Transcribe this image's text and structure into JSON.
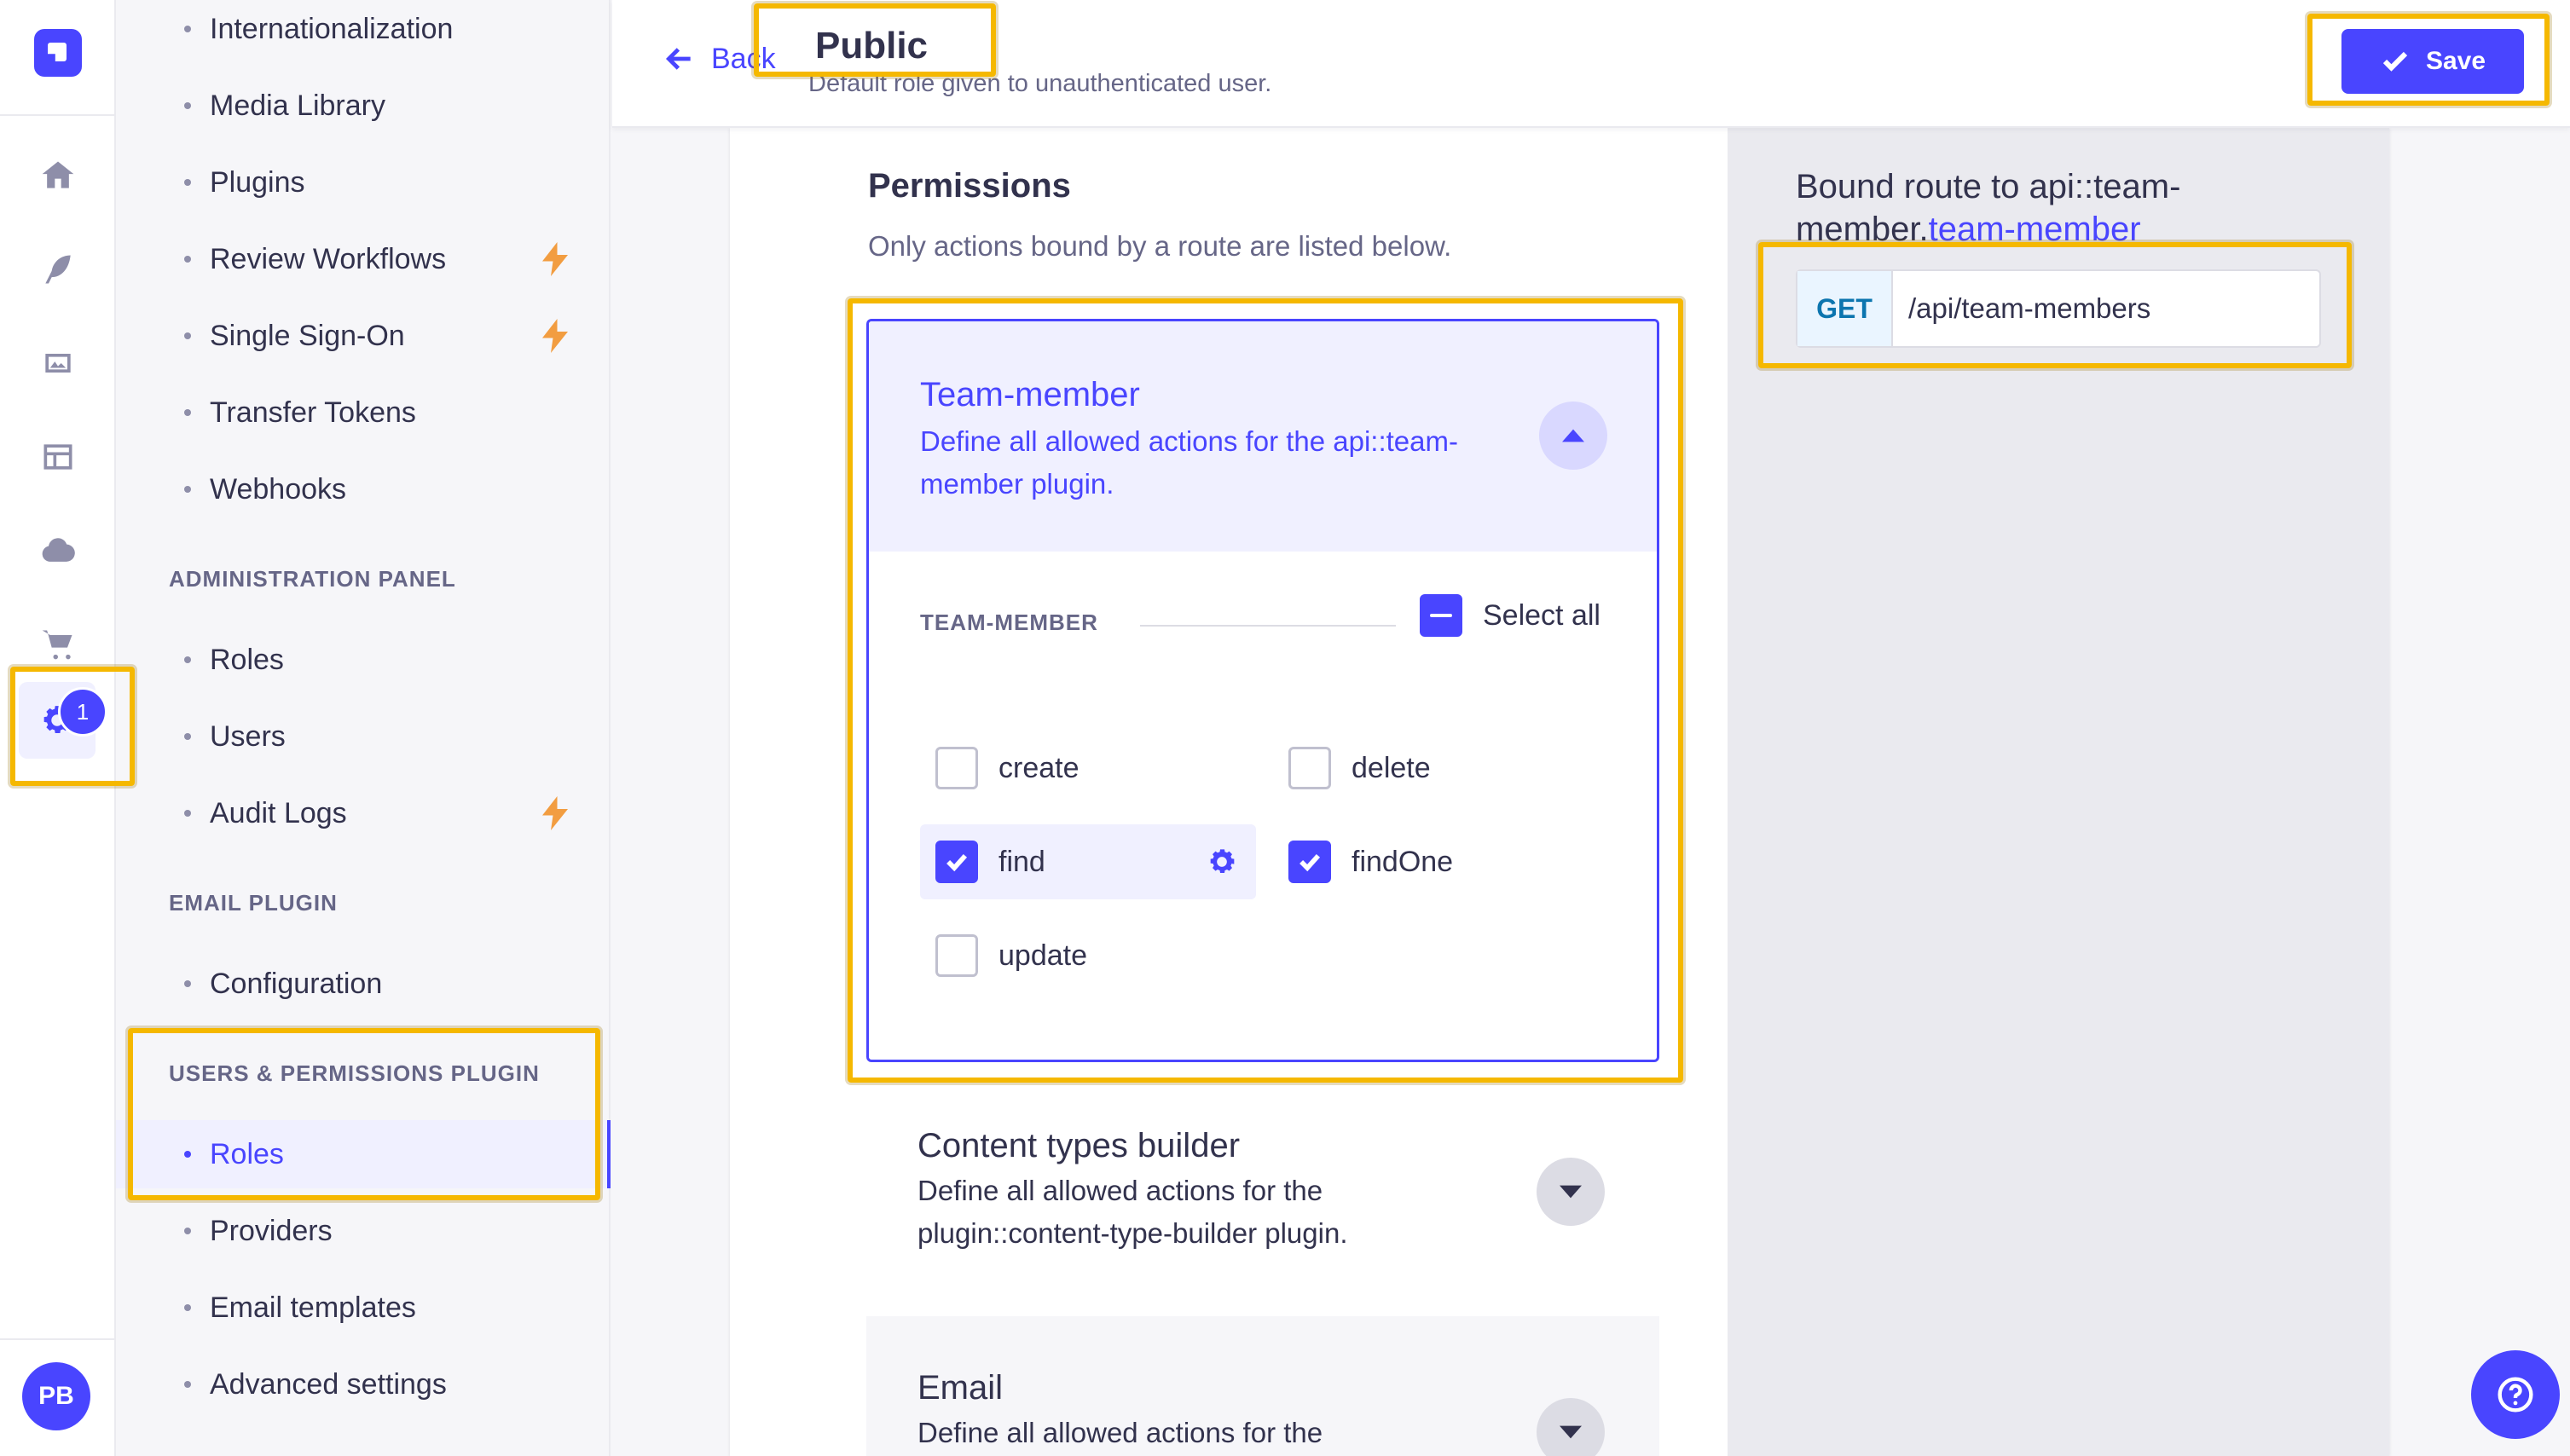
{
  "rail": {
    "badge_count": "1",
    "avatar_initials": "PB",
    "icons": [
      "home-icon",
      "feather-icon",
      "media-icon",
      "layout-icon",
      "cloud-icon",
      "cart-icon",
      "settings-icon"
    ]
  },
  "subnav": {
    "top_items": [
      {
        "label": "Internationalization",
        "bolt": false
      },
      {
        "label": "Media Library",
        "bolt": false
      },
      {
        "label": "Plugins",
        "bolt": false
      },
      {
        "label": "Review Workflows",
        "bolt": true
      },
      {
        "label": "Single Sign-On",
        "bolt": true
      },
      {
        "label": "Transfer Tokens",
        "bolt": false
      },
      {
        "label": "Webhooks",
        "bolt": false
      }
    ],
    "admin_heading": "ADMINISTRATION PANEL",
    "admin_items": [
      {
        "label": "Roles",
        "bolt": false
      },
      {
        "label": "Users",
        "bolt": false
      },
      {
        "label": "Audit Logs",
        "bolt": true
      }
    ],
    "email_heading": "EMAIL PLUGIN",
    "email_items": [
      {
        "label": "Configuration"
      }
    ],
    "up_heading": "USERS & PERMISSIONS PLUGIN",
    "up_items": [
      {
        "label": "Roles",
        "active": true
      },
      {
        "label": "Providers",
        "active": false
      },
      {
        "label": "Email templates",
        "active": false
      },
      {
        "label": "Advanced settings",
        "active": false
      }
    ]
  },
  "header": {
    "back_label": "Back",
    "title": "Public",
    "subtitle": "Default role given to unauthenticated user.",
    "save_label": "Save"
  },
  "permissions": {
    "title": "Permissions",
    "subtitle": "Only actions bound by a route are listed below.",
    "open_section": {
      "name": "Team-member",
      "description": "Define all allowed actions for the api::team-member plugin.",
      "group_label": "TEAM-MEMBER",
      "select_all_label": "Select all",
      "actions": [
        {
          "label": "create",
          "checked": false
        },
        {
          "label": "delete",
          "checked": false
        },
        {
          "label": "find",
          "checked": true
        },
        {
          "label": "findOne",
          "checked": true
        },
        {
          "label": "update",
          "checked": false
        }
      ]
    },
    "collapsed_sections": [
      {
        "name": "Content types builder",
        "description": "Define all allowed actions for the plugin::content-type-builder plugin."
      },
      {
        "name": "Email",
        "description": "Define all allowed actions for the"
      }
    ]
  },
  "bound_route": {
    "title_prefix": "Bound route to api::team-member.",
    "title_highlight": "team-member",
    "method": "GET",
    "path": "/api/team-members"
  },
  "colors": {
    "primary": "#4945ff",
    "highlight_frame": "#f5b800",
    "bolt": "#f29d41"
  }
}
